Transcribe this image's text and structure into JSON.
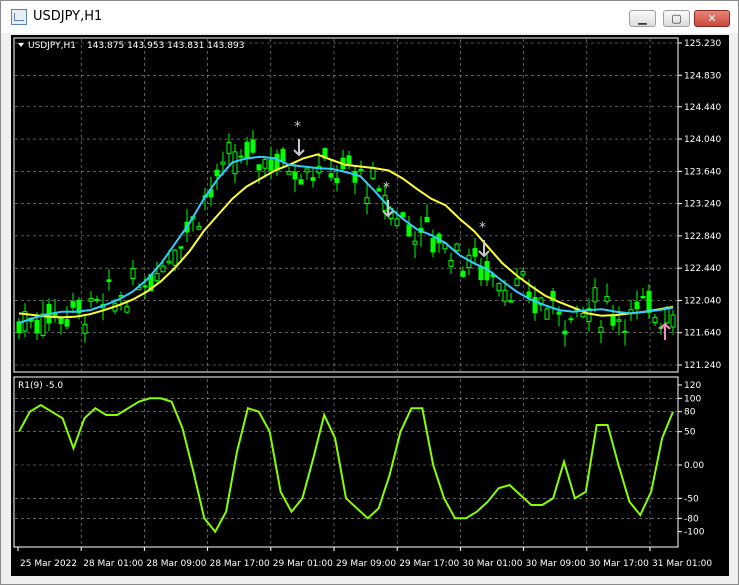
{
  "window": {
    "title": "USDJPY,H1",
    "buttons": [
      "minimize",
      "maximize",
      "close"
    ]
  },
  "chart_header": {
    "symbol_label": "USDJPY,H1",
    "ohlc": "143.875 143.953 143.831 143.893",
    "dropdown_icon": "triangle-down-icon"
  },
  "price_axis": {
    "ticks": [
      "125.230",
      "124.830",
      "124.440",
      "124.040",
      "123.640",
      "123.240",
      "122.840",
      "122.440",
      "122.040",
      "121.640",
      "121.240"
    ]
  },
  "indicator": {
    "label": "R1(9) -5.0",
    "ticks": [
      "120",
      "100",
      "80",
      "50",
      "0.00",
      "-50",
      "-80",
      "-100"
    ]
  },
  "time_axis": {
    "labels": [
      "25 Mar 2022",
      "28 Mar 01:00",
      "28 Mar 09:00",
      "28 Mar 17:00",
      "29 Mar 01:00",
      "29 Mar 09:00",
      "29 Mar 17:00",
      "30 Mar 01:00",
      "30 Mar 09:00",
      "30 Mar 17:00",
      "31 Mar 01:00"
    ]
  },
  "colors": {
    "background": "#000000",
    "candles": "#00ff00",
    "fast_ma": "#33ccff",
    "slow_ma": "#ffff33",
    "oscillator": "#88ff00",
    "sell_arrow": "#c8c8c8",
    "buy_arrow": "#ff88cc",
    "grid": "#9a9a9a",
    "axis_text": "#ffffff"
  },
  "chart_data": {
    "type": "line",
    "symbol": "USDJPY",
    "timeframe": "H1",
    "price_range": [
      121.24,
      125.23
    ],
    "fast_ma": [
      121.76,
      121.82,
      121.87,
      121.9,
      121.9,
      121.92,
      121.98,
      122.05,
      122.15,
      122.3,
      122.5,
      122.75,
      123.0,
      123.3,
      123.55,
      123.75,
      123.8,
      123.82,
      123.8,
      123.72,
      123.7,
      123.68,
      123.67,
      123.63,
      123.58,
      123.4,
      123.2,
      123.05,
      122.92,
      122.85,
      122.75,
      122.6,
      122.5,
      122.42,
      122.28,
      122.15,
      122.05,
      121.98,
      121.92,
      121.9,
      121.92,
      121.93,
      121.9,
      121.88,
      121.9,
      121.92,
      121.95
    ],
    "slow_ma": [
      121.88,
      121.86,
      121.84,
      121.83,
      121.84,
      121.87,
      121.92,
      121.98,
      122.05,
      122.15,
      122.28,
      122.45,
      122.65,
      122.9,
      123.1,
      123.3,
      123.45,
      123.55,
      123.65,
      123.72,
      123.8,
      123.85,
      123.78,
      123.72,
      123.7,
      123.68,
      123.65,
      123.55,
      123.42,
      123.3,
      123.22,
      123.05,
      122.9,
      122.7,
      122.5,
      122.35,
      122.22,
      122.1,
      122.02,
      121.95,
      121.88,
      121.85,
      121.86,
      121.88,
      121.9,
      121.93,
      121.96
    ],
    "oscillator": [
      50,
      80,
      90,
      80,
      70,
      25,
      70,
      85,
      75,
      75,
      85,
      95,
      100,
      100,
      95,
      55,
      -10,
      -80,
      -100,
      -70,
      20,
      85,
      80,
      50,
      -40,
      -70,
      -50,
      10,
      75,
      40,
      -50,
      -65,
      -80,
      -65,
      -15,
      50,
      85,
      85,
      0,
      -50,
      -80,
      -80,
      -70,
      -55,
      -35,
      -30,
      -45,
      -60,
      -60,
      -50,
      5,
      -50,
      -40,
      60,
      60,
      0,
      -55,
      -75,
      -40,
      40,
      80
    ]
  },
  "signals": {
    "sell_arrows": 4,
    "buy_arrows": 1
  }
}
